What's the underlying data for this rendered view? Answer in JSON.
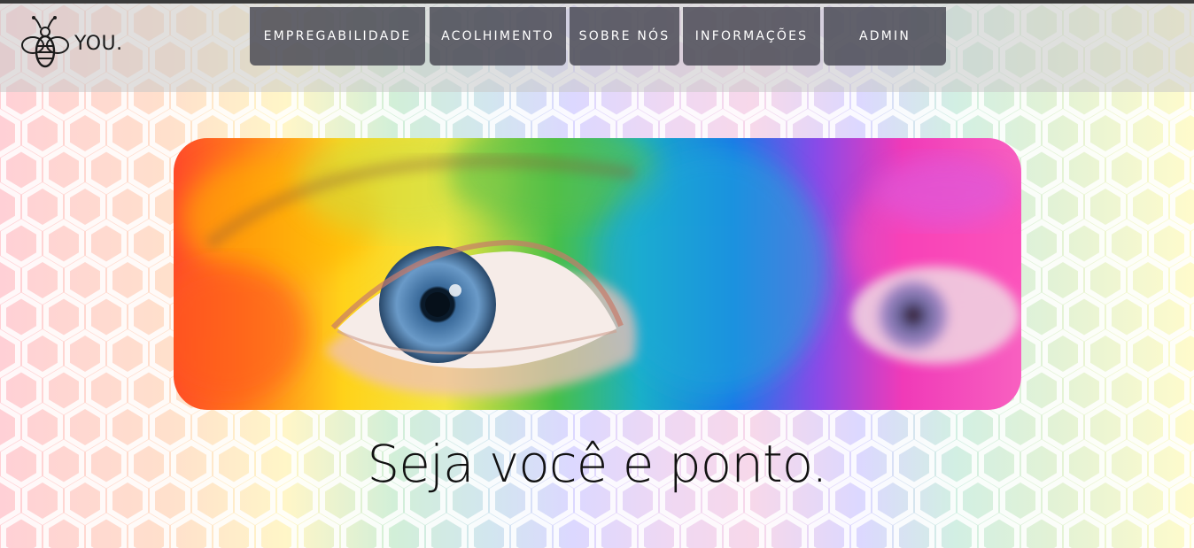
{
  "brand": {
    "logo_text": "YOU.",
    "logo_icon": "bee-icon"
  },
  "nav": {
    "items": [
      {
        "label": "EMPREGABILIDADE"
      },
      {
        "label": "ACOLHIMENTO"
      },
      {
        "label": "SOBRE NÓS"
      },
      {
        "label": "INFORMAÇÕES"
      },
      {
        "label": "ADMIN"
      }
    ]
  },
  "hero": {
    "image": "rainbow-painted-eye-image"
  },
  "tagline": "Seja você e ponto.",
  "colors": {
    "nav_bg": "#46464f",
    "nav_text": "#ffffff",
    "text": "#111111",
    "hex_lines": "#ffffff"
  }
}
